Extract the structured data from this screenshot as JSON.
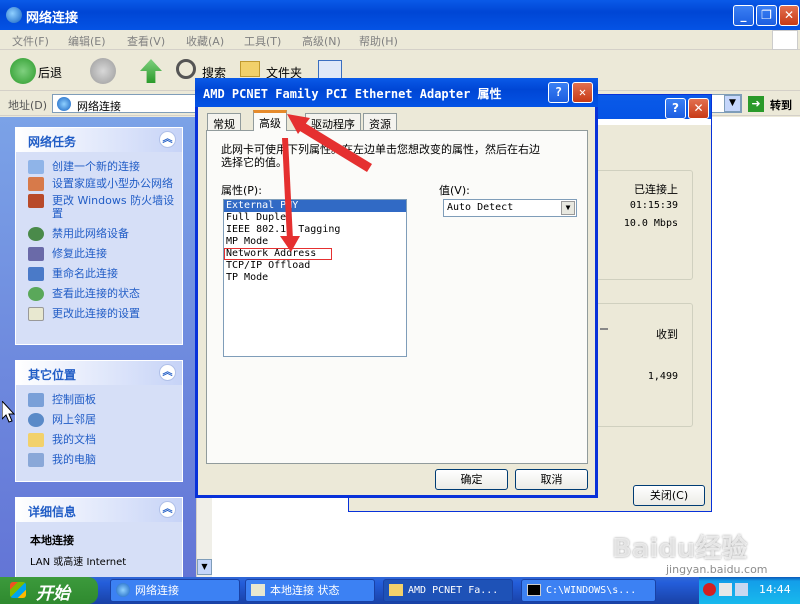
{
  "main_window": {
    "title": "网络连接",
    "menu": [
      "文件(F)",
      "编辑(E)",
      "查看(V)",
      "收藏(A)",
      "工具(T)",
      "高级(N)",
      "帮助(H)"
    ],
    "toolbar": {
      "back_label": "后退",
      "search_label": "搜索",
      "folders_label": "文件夹"
    },
    "address": {
      "label": "地址(D)",
      "value": "网络连接",
      "go_label": "转到"
    }
  },
  "left_pane": {
    "network_tasks": {
      "title": "网络任务",
      "items": [
        {
          "label": "创建一个新的连接",
          "icon": "new-connection-icon"
        },
        {
          "label": "设置家庭或小型办公网络",
          "icon": "home-network-icon"
        },
        {
          "label": "更改 Windows 防火墙设置",
          "icon": "firewall-icon"
        },
        {
          "label": "禁用此网络设备",
          "icon": "disable-device-icon"
        },
        {
          "label": "修复此连接",
          "icon": "repair-icon"
        },
        {
          "label": "重命名此连接",
          "icon": "rename-icon"
        },
        {
          "label": "查看此连接的状态",
          "icon": "status-icon"
        },
        {
          "label": "更改此连接的设置",
          "icon": "settings-icon"
        }
      ]
    },
    "other_places": {
      "title": "其它位置",
      "items": [
        {
          "label": "控制面板",
          "icon": "control-panel-icon"
        },
        {
          "label": "网上邻居",
          "icon": "network-places-icon"
        },
        {
          "label": "我的文档",
          "icon": "my-documents-icon"
        },
        {
          "label": "我的电脑",
          "icon": "my-computer-icon"
        }
      ]
    },
    "details": {
      "title": "详细信息",
      "name": "本地连接",
      "desc": "LAN 或高速 Internet"
    }
  },
  "status_dialog": {
    "status": "已连接上",
    "duration": "01:15:39",
    "speed": "10.0 Mbps",
    "received_label": "收到",
    "received_value": "1,499",
    "close_label": "关闭(C)"
  },
  "properties_dialog": {
    "title": "AMD PCNET Family PCI Ethernet Adapter 属性",
    "tabs": [
      "常规",
      "高级",
      "驱动程序",
      "资源"
    ],
    "active_tab": "高级",
    "description": "此网卡可使用下列属性。在左边单击您想改变的属性，然后在右边选择它的值。",
    "property_label": "属性(P):",
    "value_label": "值(V):",
    "properties": [
      "External PHY",
      "Full Duplex",
      "IEEE 802.1p Tagging",
      "MP Mode",
      "Network Address",
      "TCP/IP Offload",
      "TP Mode"
    ],
    "selected_property": "External PHY",
    "highlighted_property": "Network Address",
    "value": "Auto Detect",
    "ok_label": "确定",
    "cancel_label": "取消",
    "help_glyph": "?",
    "close_glyph": "✕"
  },
  "taskbar": {
    "start_label": "开始",
    "buttons": [
      "网络连接",
      "本地连接 状态",
      "AMD PCNET Fa...",
      "C:\\WINDOWS\\s..."
    ],
    "clock": "14:44"
  },
  "watermark": {
    "text": "Baidu经验",
    "url": "jingyan.baidu.com"
  },
  "colors": {
    "title_blue": "#0453e5",
    "annotation_red": "#e53030",
    "task_link": "#215dc6"
  }
}
